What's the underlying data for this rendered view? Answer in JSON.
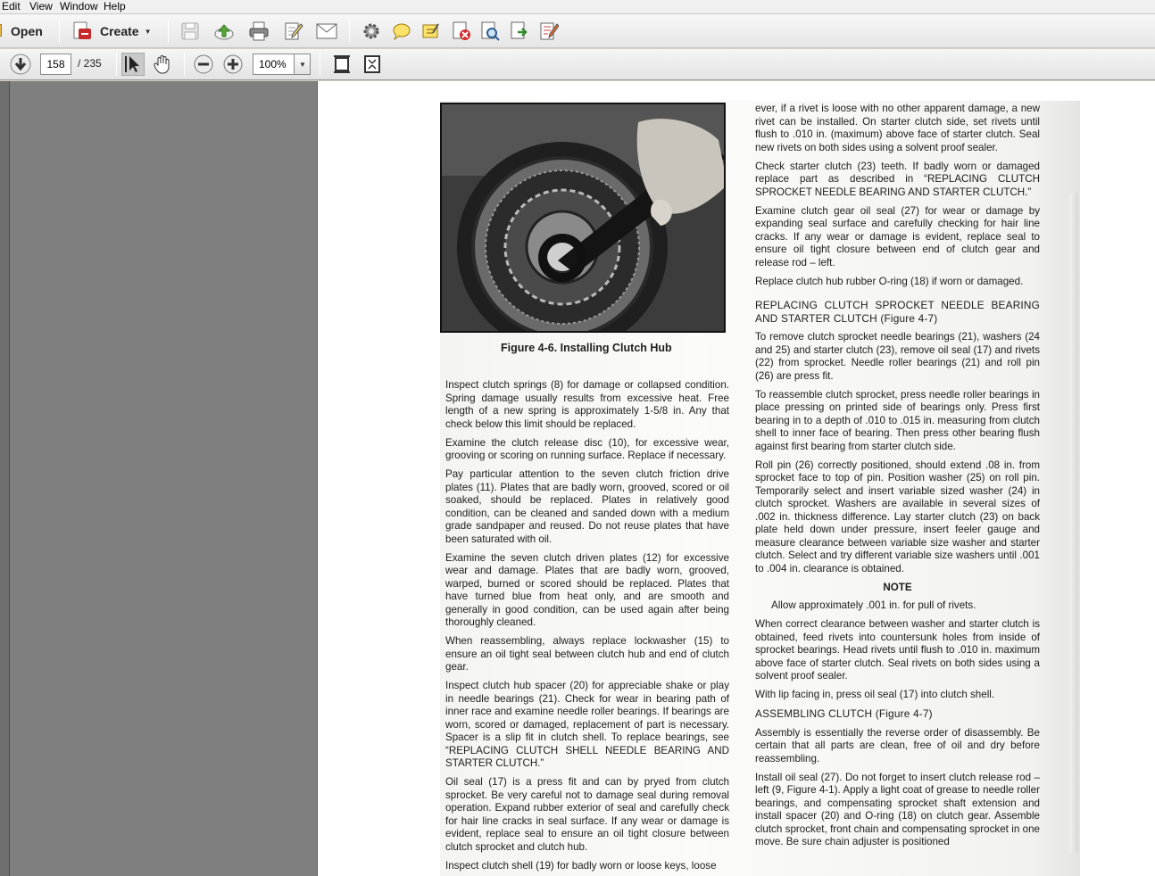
{
  "menu": [
    "Edit",
    "View",
    "Window",
    "Help"
  ],
  "toolbar": {
    "open_label": "Open",
    "create_label": "Create",
    "page_current": "158",
    "page_total": "/ 235",
    "zoom": "100%",
    "icons": [
      "open-folder-icon",
      "create-pdf-icon",
      "save-icon",
      "upload-icon",
      "print-icon",
      "edit-icon",
      "email-icon",
      "settings-icon",
      "comment-icon",
      "highlight-icon",
      "delete-pdf-icon",
      "find-icon",
      "export-icon",
      "sign-icon",
      "down-arrow-icon",
      "select-tool-icon",
      "hand-tool-icon",
      "zoom-out-icon",
      "zoom-in-icon",
      "fit-page-icon",
      "full-screen-icon"
    ]
  },
  "document": {
    "figure_caption": "Figure 4-6. Installing Clutch Hub",
    "left_column": [
      "Inspect clutch springs (8) for damage or collapsed condition. Spring damage usually results from excessive heat. Free length of a new spring is approximately 1-5/8 in. Any that check below this limit should be replaced.",
      "Examine the clutch release disc (10), for excessive wear, grooving or scoring on running surface. Replace if necessary.",
      "Pay particular attention to the seven clutch friction drive plates (11). Plates that are badly worn, grooved, scored or oil soaked, should be replaced. Plates in relatively good condition, can be cleaned and sanded down with a medium grade sandpaper and reused. Do not reuse plates that have been saturated with oil.",
      "Examine the seven clutch driven plates (12) for excessive wear and damage. Plates that are badly worn, grooved, warped, burned or scored should be replaced. Plates that have turned blue from heat only, and are smooth and generally in good condition, can be used again after being thoroughly cleaned.",
      "When reassembling, always replace lockwasher (15) to ensure an oil tight seal between clutch hub and end of clutch gear.",
      "Inspect clutch hub spacer (20) for appreciable shake or play in needle bearings (21). Check for wear in bearing path of inner race and examine needle roller bearings. If bearings are worn, scored or damaged, replacement of part is necessary. Spacer is a slip fit in clutch shell. To replace bearings, see “REPLACING CLUTCH SHELL NEEDLE BEARING AND STARTER CLUTCH.”",
      "Oil seal (17) is a press fit and can by pryed from clutch sprocket. Be very careful not to damage seal during removal operation. Expand rubber exterior of seal and carefully check for hair line cracks in seal surface. If any wear or damage is evident, replace seal to ensure an oil tight closure between clutch sprocket and clutch hub.",
      "Inspect clutch shell (19) for badly worn or loose keys, loose"
    ],
    "right_column": [
      "ever, if a rivet is loose with no other apparent damage, a new rivet can be installed. On starter clutch side, set rivets until flush to .010 in. (maximum) above face of starter clutch. Seal new rivets on both sides using a solvent proof sealer.",
      "Check starter clutch (23) teeth. If badly worn or damaged replace part as described in “REPLACING CLUTCH SPROCKET NEEDLE BEARING AND STARTER CLUTCH.”",
      "Examine clutch gear oil seal (27) for wear or damage by expanding seal surface and carefully checking for hair line cracks. If any wear or damage is evident, replace seal to ensure oil tight closure between end of clutch gear and release rod – left.",
      "Replace clutch hub rubber O-ring (18) if worn or damaged."
    ],
    "heading_sprocket": "REPLACING CLUTCH SPROCKET NEEDLE BEARING AND STARTER CLUTCH (Figure 4-7)",
    "right_column_2": [
      "To remove clutch sprocket needle bearings (21), washers (24 and 25) and starter clutch (23), remove oil seal (17) and rivets (22) from sprocket. Needle roller bearings (21) and roll pin (26) are press fit.",
      "To reassemble clutch sprocket, press needle roller bearings in place pressing on printed side of bearings only. Press first bearing in to a depth of .010 to .015 in. measuring from clutch shell to inner face of bearing. Then press other bearing flush against first bearing from starter clutch side.",
      "Roll pin (26) correctly positioned, should extend .08 in. from sprocket face to top of pin. Position washer (25) on roll pin. Temporarily select and insert variable sized washer (24) in clutch sprocket. Washers are available in several sizes of .002 in. thickness difference. Lay starter clutch (23) on back plate held down under pressure, insert feeler gauge and measure clearance between variable size washer and starter clutch. Select and try different variable size washers until .001 to .004 in. clearance is obtained."
    ],
    "note_title": "NOTE",
    "note_text": "Allow approximately .001 in. for pull of rivets.",
    "right_column_3": [
      "When correct clearance between washer and starter clutch is obtained, feed rivets into countersunk holes from inside of sprocket bearings. Head rivets until flush to .010 in. maximum above face of starter clutch. Seal rivets on both sides using a solvent proof sealer.",
      "With lip facing in, press oil seal (17) into clutch shell."
    ],
    "heading_assembling": "ASSEMBLING CLUTCH (Figure 4-7)",
    "right_column_4": [
      "Assembly is essentially the reverse order of disassembly. Be certain that all parts are clean, free of oil and dry before reassembling.",
      "Install oil seal (27). Do not forget to insert clutch release rod – left (9, Figure 4-1). Apply a light coat of grease to needle roller bearings, and compensating sprocket shaft extension and install spacer (20) and O-ring (18) on clutch gear. Assemble clutch sprocket, front chain and compensating sprocket in one move. Be sure chain adjuster is positioned"
    ]
  }
}
